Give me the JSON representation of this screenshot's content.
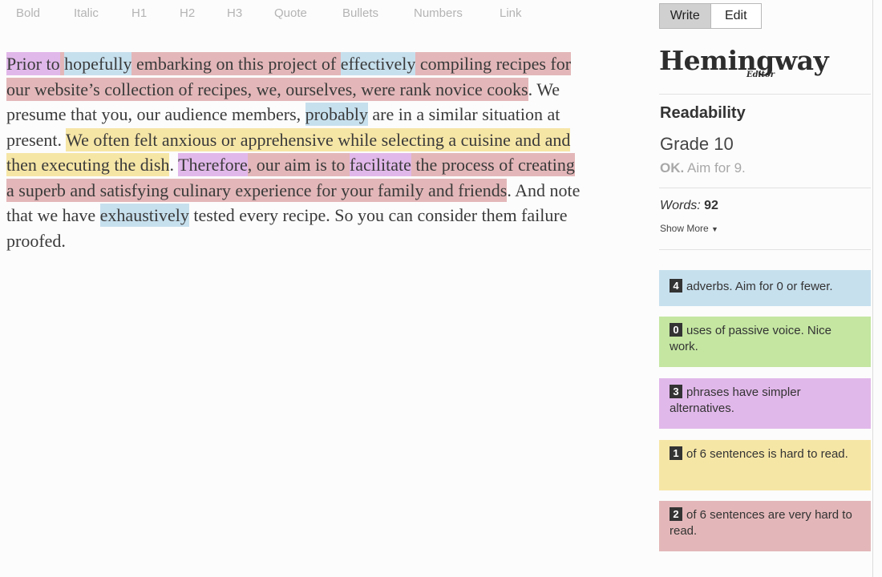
{
  "toolbar": {
    "bold": "Bold",
    "italic": "Italic",
    "h1": "H1",
    "h2": "H2",
    "h3": "H3",
    "quote": "Quote",
    "bullets": "Bullets",
    "numbers": "Numbers",
    "link": "Link"
  },
  "mode": {
    "write": "Write",
    "edit": "Edit",
    "active": "Write"
  },
  "logo": {
    "name": "Hemingway",
    "sub": "Editor"
  },
  "readability": {
    "title": "Readability",
    "grade": "Grade 10",
    "status": "OK.",
    "aim": "Aim for 9."
  },
  "stats": {
    "words_label": "Words:",
    "words_value": "92",
    "show_more": "Show More"
  },
  "cards": {
    "adverbs": {
      "count": "4",
      "text": "adverbs. Aim for 0 or fewer."
    },
    "passive": {
      "count": "0",
      "text": "uses of passive voice. Nice work."
    },
    "phrases": {
      "count": "3",
      "text": "phrases have simpler alternatives."
    },
    "hard": {
      "count": "1",
      "text": "of 6 sentences is hard to read."
    },
    "very_hard": {
      "count": "2",
      "text": "of 6 sentences are very hard to read."
    }
  },
  "colors": {
    "very_hard": "#e3b7b9",
    "hard": "#f6e6a6",
    "adverb": "#c7e0ee",
    "passive": "#c4e6a1",
    "simpler": "#e1b8ea"
  },
  "editor": {
    "segments": [
      {
        "text": " ",
        "hl": "red"
      },
      {
        "text": "Prior to",
        "hl": "purple"
      },
      {
        "text": " ",
        "hl": "red"
      },
      {
        "text": "hopefully",
        "hl": "blue"
      },
      {
        "text": " embarking on this project of ",
        "hl": "red"
      },
      {
        "text": "effectively",
        "hl": "blue"
      },
      {
        "text": " compiling recipes for our website’s collection of recipes, we, ourselves, were rank novice cooks",
        "hl": "red"
      },
      {
        "text": ". We presume that you, our audience members, ",
        "hl": ""
      },
      {
        "text": "probably",
        "hl": "blue"
      },
      {
        "text": " are in a similar situation at present. ",
        "hl": ""
      },
      {
        "text": "We often felt anxious or apprehensive while selecting a cuisine and and then executing the dish",
        "hl": "yellow"
      },
      {
        "text": ". ",
        "hl": ""
      },
      {
        "text": "Therefore",
        "hl": "purple"
      },
      {
        "text": ", our aim is to ",
        "hl": "red"
      },
      {
        "text": "facilitate",
        "hl": "purple"
      },
      {
        "text": " the process of creating a superb and satisfying culinary experience for your family and friends",
        "hl": "red"
      },
      {
        "text": ". And note that we have ",
        "hl": ""
      },
      {
        "text": "exhaustively",
        "hl": "blue"
      },
      {
        "text": " tested every recipe. So you can consider them failure proofed.",
        "hl": ""
      }
    ]
  }
}
